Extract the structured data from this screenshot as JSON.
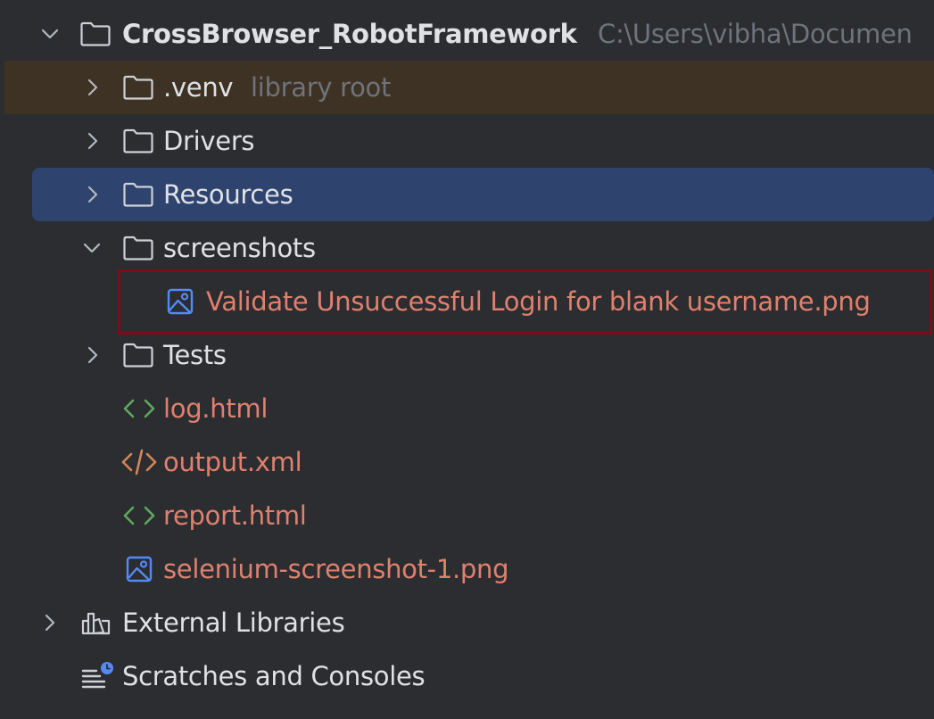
{
  "tree": {
    "root": {
      "name": "CrossBrowser_RobotFramework",
      "path": "C:\\Users\\vibha\\Documen",
      "expanded": true
    },
    "items": [
      {
        "label": ".venv",
        "hint": "library root",
        "type": "folder",
        "expanded": false
      },
      {
        "label": "Drivers",
        "type": "folder",
        "expanded": false
      },
      {
        "label": "Resources",
        "type": "folder",
        "expanded": false,
        "selected": true
      },
      {
        "label": "screenshots",
        "type": "folder",
        "expanded": true
      },
      {
        "label": "Validate Unsuccessful Login for blank username.png",
        "type": "image-file"
      },
      {
        "label": "Tests",
        "type": "folder",
        "expanded": false
      },
      {
        "label": "log.html",
        "type": "html-file"
      },
      {
        "label": "output.xml",
        "type": "xml-file"
      },
      {
        "label": "report.html",
        "type": "html-file"
      },
      {
        "label": "selenium-screenshot-1.png",
        "type": "image-file"
      }
    ],
    "external_libraries": "External Libraries",
    "scratches": "Scratches and Consoles"
  },
  "colors": {
    "background": "#2b2d30",
    "selected_row": "#2e436e",
    "library_row": "#3d3223",
    "text": "#dfe1e5",
    "modified_text": "#e0806e",
    "hint_text": "#6f737a",
    "highlight_border": "#7a0f1a",
    "html_icon": "#5fa95f",
    "xml_icon": "#d4865a",
    "image_icon": "#548af7"
  }
}
